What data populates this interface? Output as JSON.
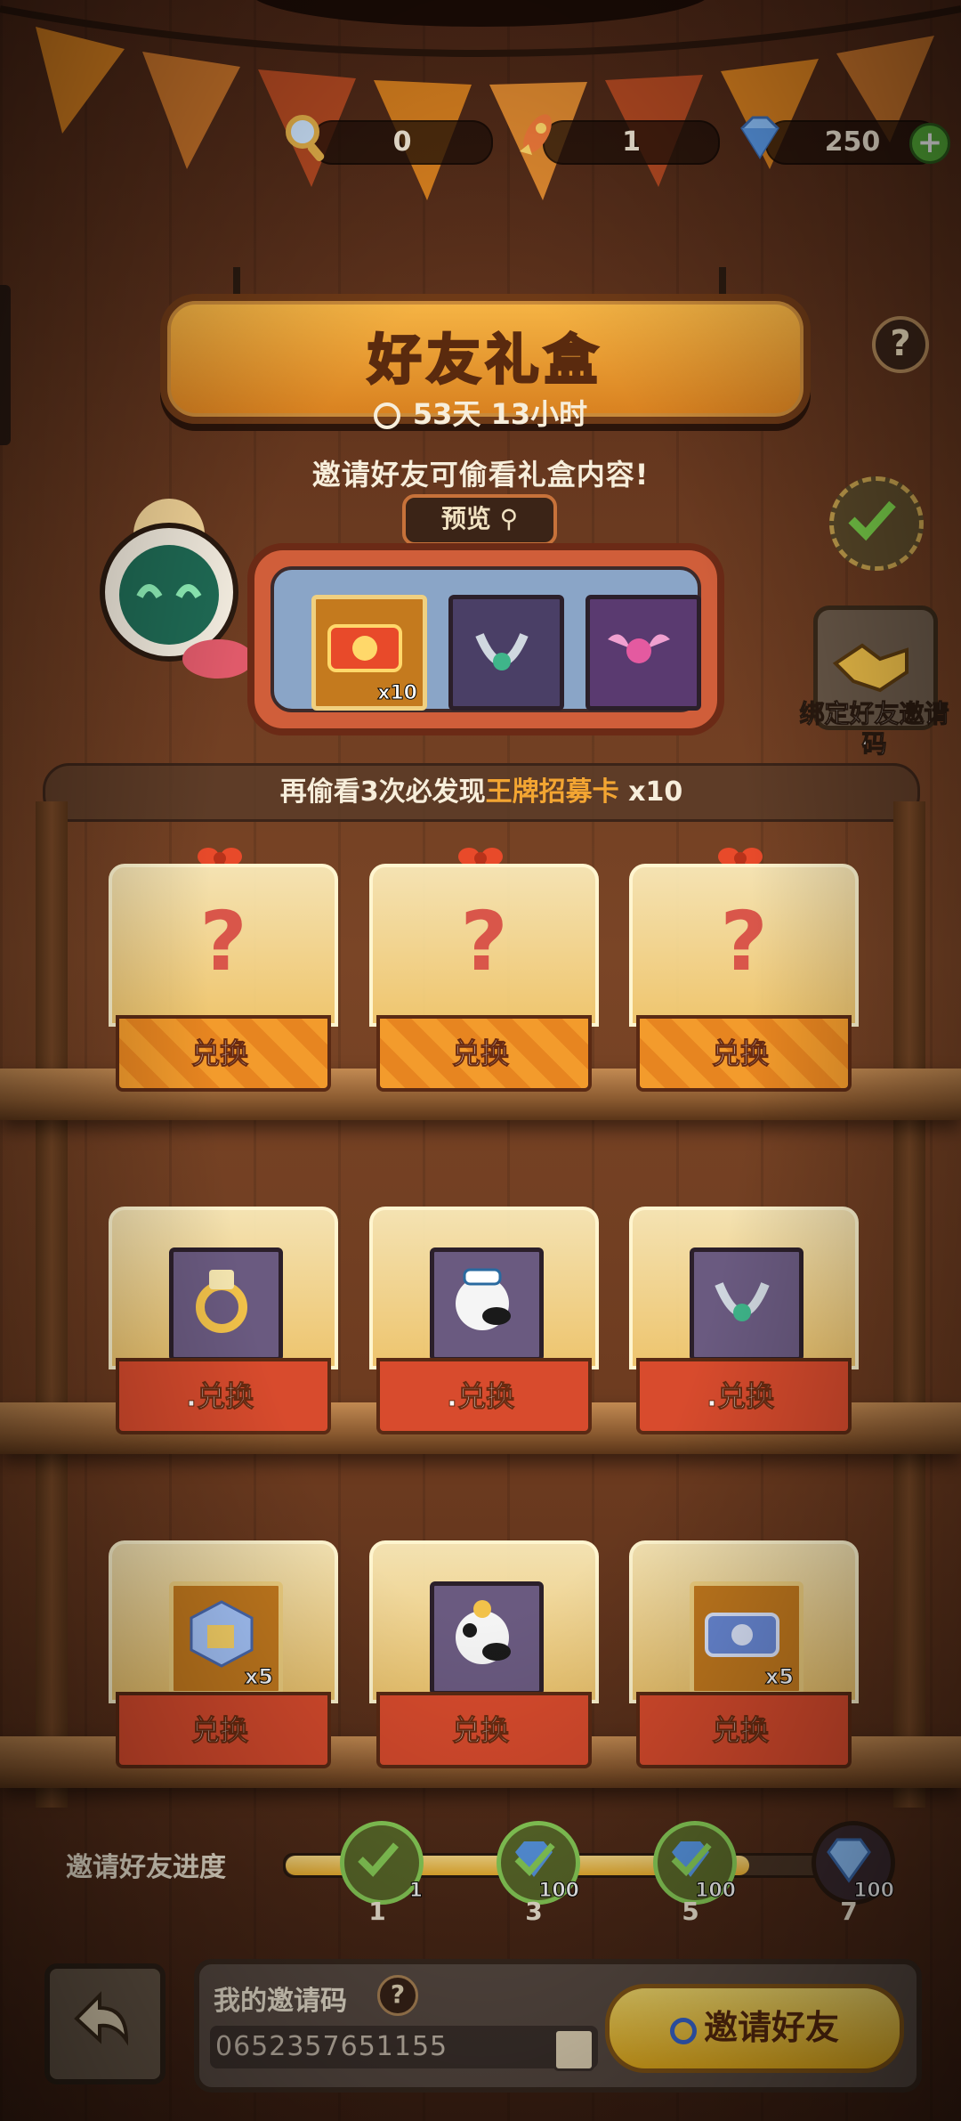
{
  "currency": {
    "magnifier_count": "0",
    "rocket_count": "1",
    "gem_count": "250",
    "add_label": "+"
  },
  "sign": {
    "title": "好友礼盒",
    "help": "?"
  },
  "timer": "53天 13小时",
  "subtitle": "邀请好友可偷看礼盒内容!",
  "preview_button": "预览",
  "preview_items": [
    {
      "icon": "ace-card-icon",
      "qty": "x10"
    },
    {
      "icon": "horn-ring-icon",
      "qty": ""
    },
    {
      "icon": "winged-charm-icon",
      "qty": ""
    }
  ],
  "bind_friend": {
    "label": "绑定好友邀请码"
  },
  "banner": {
    "prefix": "再偷看3次必发现",
    "highlight": "王牌招募卡",
    "suffix": " x10"
  },
  "mystery_boxes": {
    "question": "?",
    "labels": [
      "兑换",
      "兑换",
      "兑换"
    ]
  },
  "row2": {
    "labels": [
      ".兑换",
      ".兑换",
      ".兑换"
    ]
  },
  "row3": {
    "items": [
      {
        "icon": "gold-cube-icon",
        "qty": "x5"
      },
      {
        "icon": "cow-dog-character-icon",
        "qty": ""
      },
      {
        "icon": "ace-card-blue-icon",
        "qty": "x5"
      }
    ],
    "labels": [
      "兑换",
      "兑换",
      "兑换"
    ]
  },
  "progress": {
    "label": "邀请好友进度",
    "fraction": 0.79,
    "nodes": [
      {
        "step": "1",
        "value": "1",
        "done": true
      },
      {
        "step": "3",
        "value": "100",
        "done": true
      },
      {
        "step": "5",
        "value": "100",
        "done": true
      },
      {
        "step": "7",
        "value": "100",
        "done": false
      }
    ]
  },
  "invite": {
    "code_label": "我的邀请码",
    "help": "?",
    "code": "0652357651155",
    "invite_button": "邀请好友"
  },
  "colors": {
    "accent_orange": "#f3a532",
    "button_yellow": "#f2b71e",
    "base_red": "#d84b2d",
    "progress_green": "#8cd35a"
  }
}
